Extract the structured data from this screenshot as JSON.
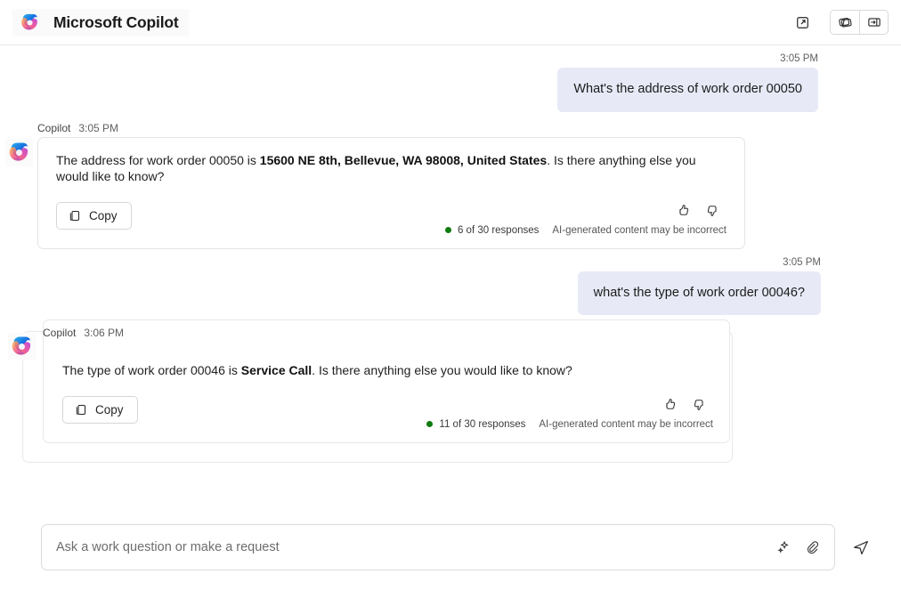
{
  "header": {
    "brand_title": "Microsoft Copilot",
    "logo_icon": "copilot-logo",
    "actions": [
      {
        "icon": "open-in-new-icon",
        "name": "pop-out-button"
      },
      {
        "icon": "pages-icon",
        "name": "pages-button"
      },
      {
        "icon": "collapse-panel-icon",
        "name": "collapse-panel-button"
      }
    ]
  },
  "conversation": [
    {
      "role": "user",
      "time": "3:05 PM",
      "text": "What's the address of work order 00050"
    },
    {
      "role": "assistant",
      "author": "Copilot",
      "time": "3:05 PM",
      "text_before": "The address for work order 00050 is ",
      "text_bold": "15600 NE 8th, Bellevue, WA 98008, United States",
      "text_after": ". Is there anything else you would like to know?",
      "copy_label": "Copy",
      "copy_icon": "copy-icon",
      "thumbs_up_icon": "thumbs-up-icon",
      "thumbs_down_icon": "thumbs-down-icon",
      "response_count": "6 of 30 responses",
      "disclaimer": "AI-generated content may be incorrect"
    },
    {
      "role": "user",
      "time": "3:05 PM",
      "text": "what's the type of work order 00046?"
    },
    {
      "role": "assistant",
      "author": "Copilot",
      "time": "3:06 PM",
      "text_before": "The type of work order 00046 is ",
      "text_bold": "Service Call",
      "text_after": ". Is there anything else you would like to know?",
      "copy_label": "Copy",
      "copy_icon": "copy-icon",
      "thumbs_up_icon": "thumbs-up-icon",
      "thumbs_down_icon": "thumbs-down-icon",
      "response_count": "11 of 30 responses",
      "disclaimer": "AI-generated content may be incorrect"
    }
  ],
  "composer": {
    "placeholder": "Ask a work question or make a request",
    "value": "",
    "prompt_icon": "sparkle-icon",
    "attach_icon": "paperclip-icon",
    "send_icon": "send-icon"
  },
  "colors": {
    "user_bubble": "#e7eaf6",
    "status_dot": "#107c10",
    "card_border": "#e4e4e4"
  }
}
